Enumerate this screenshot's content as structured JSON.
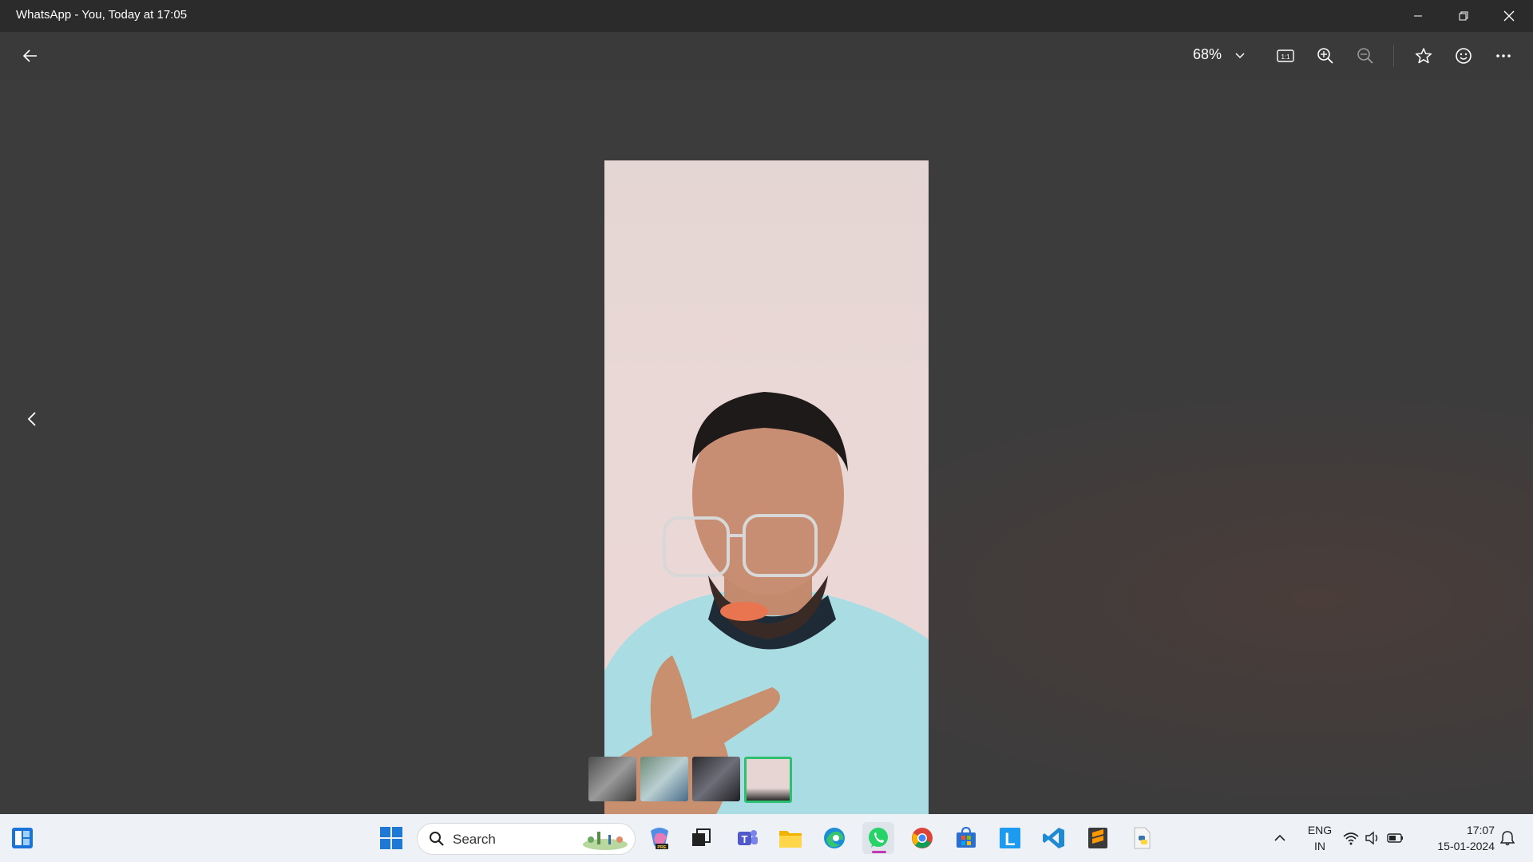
{
  "window": {
    "title": "WhatsApp - You, Today at 17:05"
  },
  "toolbar": {
    "zoom": "68%"
  },
  "thumbnails": [
    {
      "label": "thumbnail-1",
      "active": false
    },
    {
      "label": "thumbnail-2",
      "active": false
    },
    {
      "label": "thumbnail-3",
      "active": false
    },
    {
      "label": "thumbnail-4",
      "active": true
    }
  ],
  "taskbar": {
    "search_placeholder": "Search",
    "language": "ENG",
    "region": "IN",
    "time": "17:07",
    "date": "15-01-2024"
  },
  "colors": {
    "accent": "#2fbf71",
    "titlebar": "#2b2b2b",
    "background": "#3c3c3c"
  }
}
